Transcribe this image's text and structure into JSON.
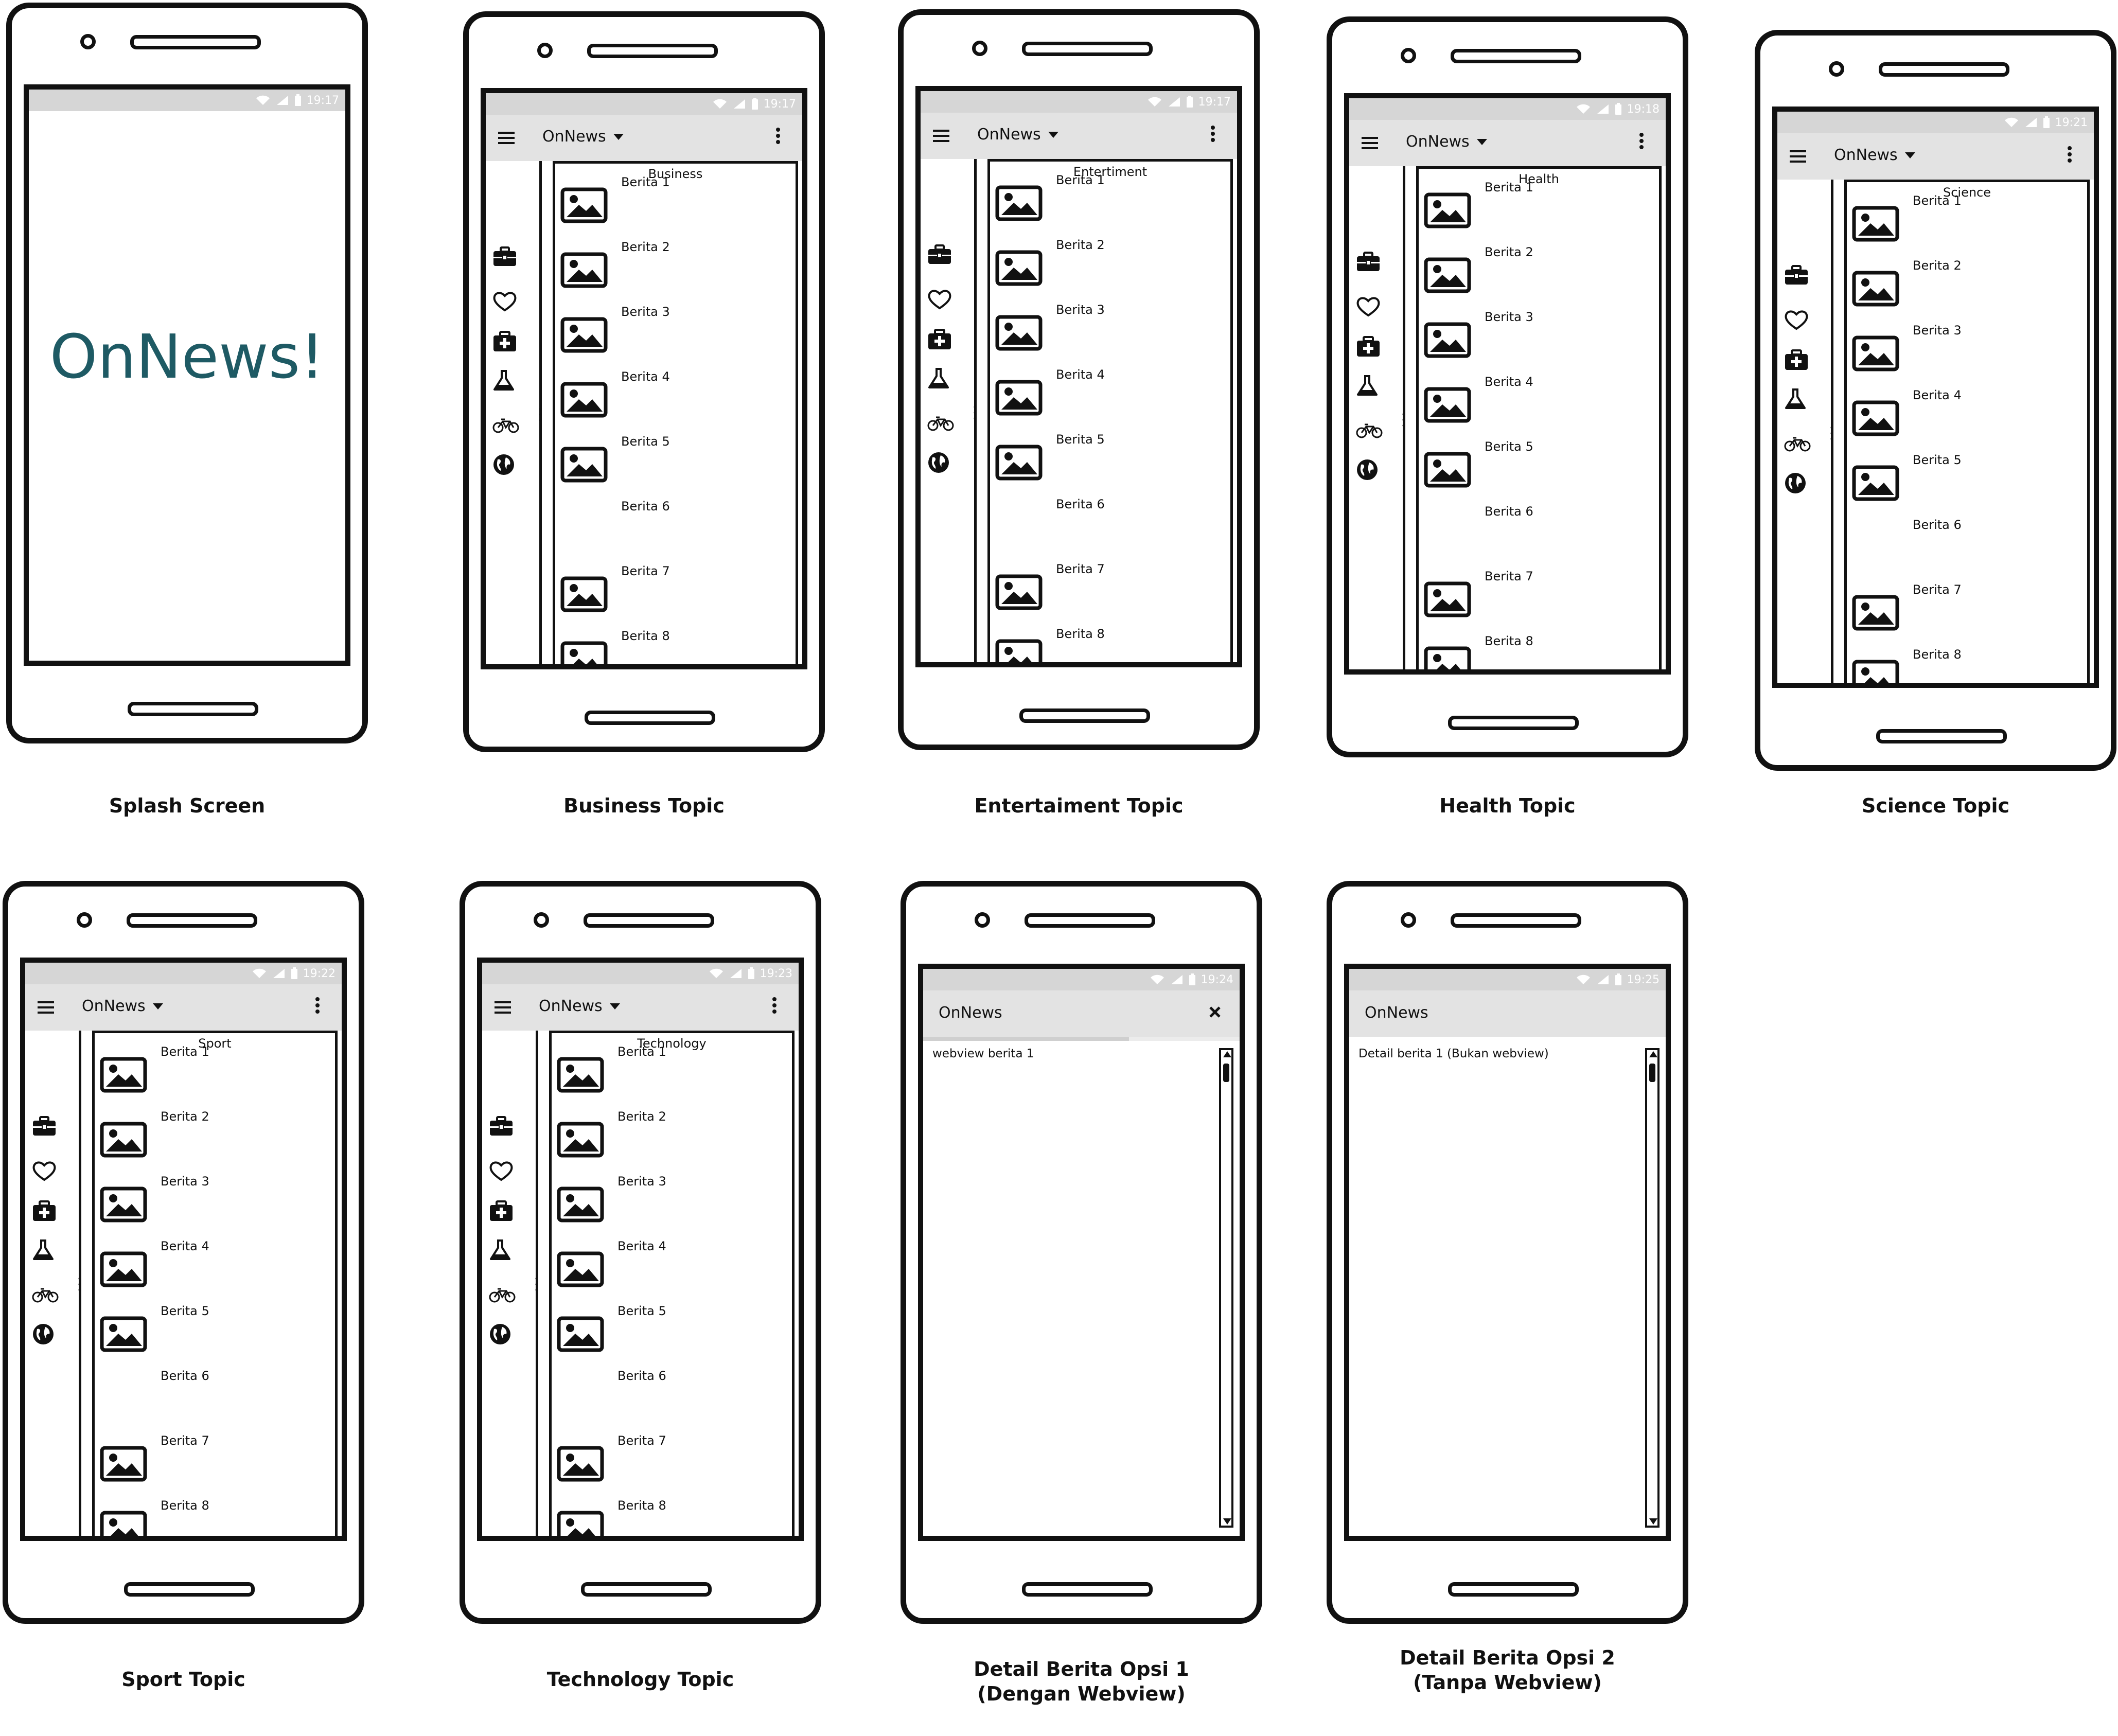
{
  "app_name": "OnNews",
  "splash": {
    "text": "OnNews!",
    "time": "19:17",
    "caption": "Splash Screen"
  },
  "topics": [
    {
      "caption": "Business Topic",
      "list_title": "Business",
      "time": "19:17"
    },
    {
      "caption": "Entertaiment Topic",
      "list_title": "Entertiment",
      "time": "19:17"
    },
    {
      "caption": "Health Topic",
      "list_title": "Health",
      "time": "19:18"
    },
    {
      "caption": "Science Topic",
      "list_title": "Science",
      "time": "19:21"
    },
    {
      "caption": "Sport Topic",
      "list_title": "Sport",
      "time": "19:22"
    },
    {
      "caption": "Technology Topic",
      "list_title": "Technology",
      "time": "19:23"
    }
  ],
  "news_items": [
    "Berita 1",
    "Berita 2",
    "Berita 3",
    "Berita 4",
    "Berita 5",
    "Berita 6",
    "Berita 7",
    "Berita 8"
  ],
  "detail1": {
    "time": "19:24",
    "body": "webview berita 1",
    "caption_line1": "Detail Berita Opsi 1",
    "caption_line2": "(Dengan Webview)"
  },
  "detail2": {
    "time": "19:25",
    "body": "Detail berita 1 (Bukan webview)",
    "caption_line1": "Detail Berita Opsi 2",
    "caption_line2": "(Tanpa Webview)"
  },
  "rail_icons": [
    "briefcase-icon",
    "heart-icon",
    "medical-kit-icon",
    "flask-icon",
    "bicycle-icon",
    "globe-icon"
  ],
  "colors": {
    "splash_text": "#1e5a64",
    "status_bar": "#d6d6d6",
    "app_bar": "#e3e3e3"
  }
}
